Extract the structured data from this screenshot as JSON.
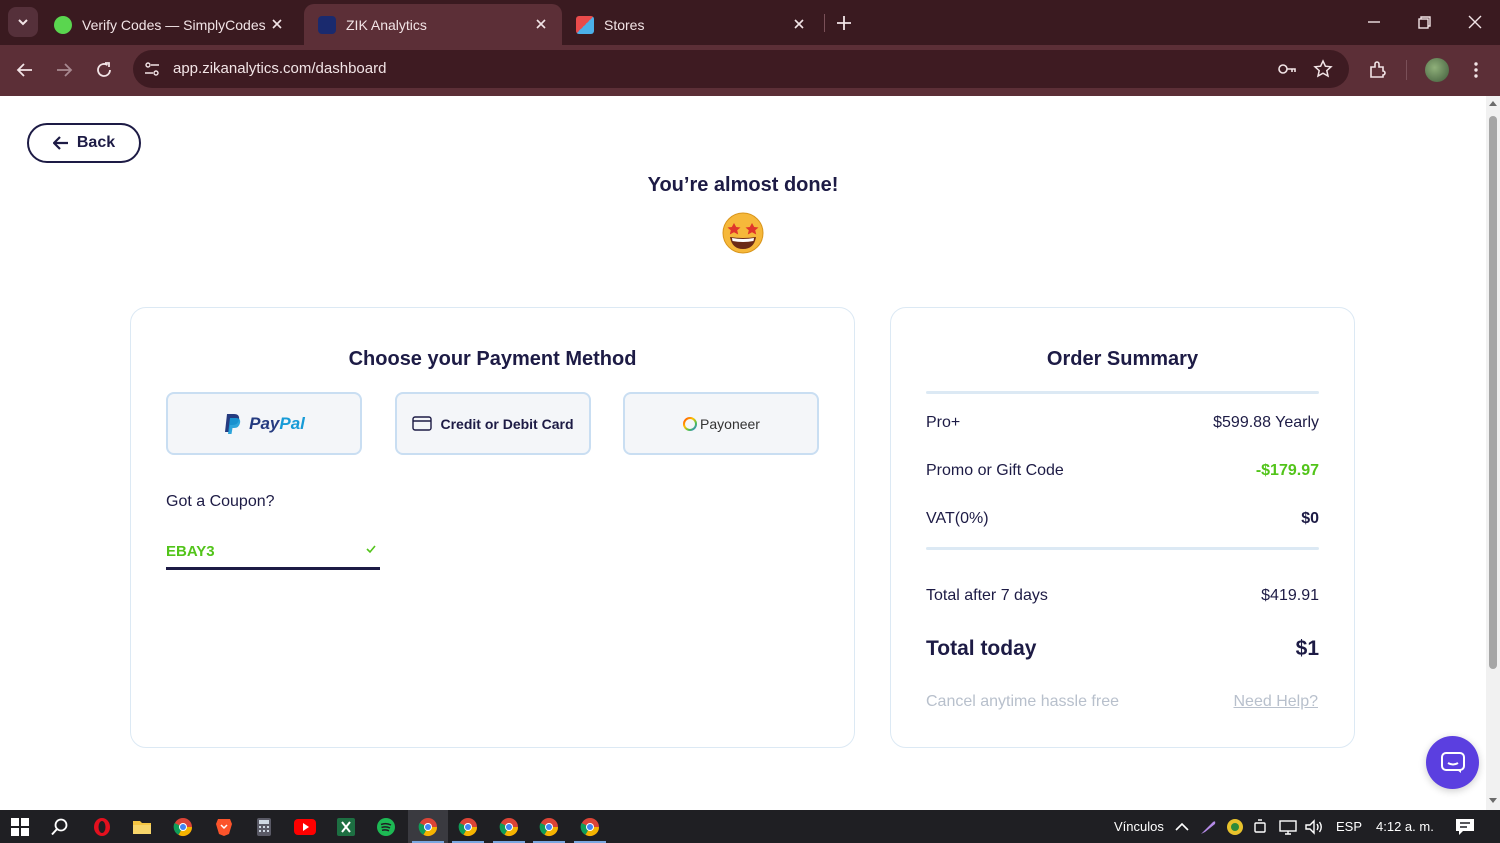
{
  "browser": {
    "tabs": [
      {
        "title": "Verify Codes — SimplyCodes",
        "active": false
      },
      {
        "title": "ZIK Analytics",
        "active": true
      },
      {
        "title": "Stores",
        "active": false
      }
    ],
    "url": "app.zikanalytics.com/dashboard"
  },
  "page": {
    "back_label": "Back",
    "title": "You’re almost done!",
    "emoji_icon": "star-struck-emoji-icon"
  },
  "payment": {
    "title": "Choose your Payment Method",
    "paypal_a": "Pay",
    "paypal_b": "Pal",
    "card_label": "Credit or Debit Card",
    "payoneer_label": "Payoneer",
    "coupon_label": "Got a Coupon?",
    "coupon_value": "EBAY3"
  },
  "summary": {
    "title": "Order Summary",
    "plan_label": "Pro+",
    "plan_price": "$599.88 Yearly",
    "promo_label": "Promo or Gift Code",
    "promo_value": "-$179.97",
    "vat_label": "VAT(0%)",
    "vat_value": "$0",
    "after_label": "Total after 7 days",
    "after_value": "$419.91",
    "today_label": "Total today",
    "today_value": "$1",
    "cancel_text": "Cancel anytime hassle free",
    "help_link": "Need Help?"
  },
  "taskbar": {
    "links_label": "Vínculos",
    "language": "ESP",
    "time": "4:12 a. m."
  },
  "colors": {
    "brand_dark": "#1d1b45",
    "success_green": "#52c41a",
    "chat_purple": "#5b3fe0",
    "chrome_frame": "#3a1a20"
  }
}
